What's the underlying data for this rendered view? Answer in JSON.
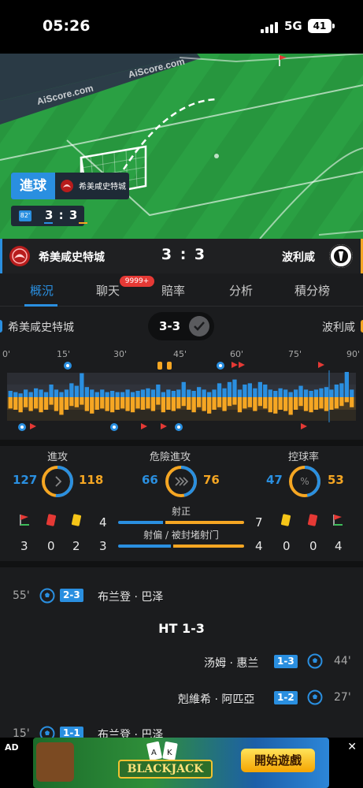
{
  "status_bar": {
    "time": "05:26",
    "network": "5G",
    "battery": "41"
  },
  "pitch": {
    "watermark_1": "AiScore.com",
    "watermark_2": "AiScore.com",
    "event_tag": "進球",
    "event_team": "希美咸史特城",
    "minute": "82'",
    "live_score": "3 : 3"
  },
  "scoreboard": {
    "home": "希美咸史特城",
    "away": "波利咸",
    "score": "3 : 3"
  },
  "tabs": [
    {
      "label": "概況",
      "active": true
    },
    {
      "label": "聊天",
      "badge": "9999+"
    },
    {
      "label": "賠率"
    },
    {
      "label": "分析"
    },
    {
      "label": "積分榜"
    }
  ],
  "match_info": {
    "home": "希美咸史特城",
    "away": "波利咸",
    "result": "3-3"
  },
  "momentum": {
    "ticks": [
      "0'",
      "15'",
      "30'",
      "45'",
      "60'",
      "75'",
      "90'"
    ],
    "home_values": [
      0.25,
      0.2,
      0.15,
      0.3,
      0.2,
      0.35,
      0.3,
      0.2,
      0.5,
      0.3,
      0.2,
      0.3,
      0.55,
      0.45,
      0.95,
      0.4,
      0.3,
      0.2,
      0.3,
      0.2,
      0.25,
      0.2,
      0.2,
      0.3,
      0.2,
      0.25,
      0.3,
      0.35,
      0.3,
      0.5,
      0.2,
      0.3,
      0.25,
      0.3,
      0.6,
      0.3,
      0.25,
      0.4,
      0.3,
      0.2,
      0.3,
      0.55,
      0.35,
      0.6,
      0.7,
      0.3,
      0.5,
      0.55,
      0.35,
      0.6,
      0.5,
      0.3,
      0.25,
      0.35,
      0.3,
      0.2,
      0.3,
      0.45,
      0.3,
      0.25,
      0.3,
      0.35,
      0.4,
      0.3,
      0.5,
      0.55,
      1.0,
      0.3
    ],
    "away_values": [
      0.45,
      0.5,
      0.6,
      0.4,
      0.55,
      0.45,
      0.6,
      0.5,
      0.3,
      0.55,
      0.7,
      0.5,
      0.35,
      0.4,
      0.3,
      0.55,
      0.65,
      0.5,
      0.45,
      0.55,
      0.6,
      0.5,
      0.45,
      0.55,
      0.6,
      0.45,
      0.5,
      0.45,
      0.55,
      0.3,
      0.6,
      0.5,
      0.55,
      0.45,
      0.35,
      0.5,
      0.6,
      0.4,
      0.55,
      0.65,
      0.5,
      0.4,
      0.55,
      0.35,
      0.3,
      0.6,
      0.45,
      0.4,
      0.55,
      0.35,
      0.45,
      0.6,
      0.65,
      0.5,
      0.55,
      0.7,
      0.5,
      0.35,
      0.55,
      0.6,
      0.5,
      0.45,
      0.55,
      0.5,
      0.45,
      0.35,
      0.2,
      0.4
    ]
  },
  "stats": {
    "attacks": {
      "label": "進攻",
      "home": "127",
      "away": "118",
      "home_frac": 0.518
    },
    "dangerous": {
      "label": "危險進攻",
      "home": "66",
      "away": "76",
      "home_frac": 0.465
    },
    "possession": {
      "label": "控球率",
      "home": "47",
      "away": "53",
      "home_frac": 0.47
    },
    "on_target": {
      "label": "射正",
      "home": "4",
      "away": "7",
      "home_frac": 0.364
    },
    "off_target": {
      "label": "射偏 / 被封堵射门",
      "home": "3",
      "away": "4",
      "home_frac": 0.43
    },
    "home_cards": {
      "corners": "3",
      "red": "0",
      "yellow": "2"
    },
    "away_cards": {
      "yellow": "0",
      "red": "0",
      "corners": "4"
    }
  },
  "events": {
    "e1": {
      "minute": "55'",
      "score": "2-3",
      "player": "布兰登 · 巴泽"
    },
    "ht": "HT 1-3",
    "e2": {
      "minute": "44'",
      "score": "1-3",
      "player": "汤姆 · 惠兰"
    },
    "e3": {
      "minute": "27'",
      "score": "1-2",
      "player": "剋維希 · 阿匹亞"
    },
    "e4": {
      "minute": "15'",
      "score": "1-1",
      "player": "布兰登 · 巴泽"
    }
  },
  "ad": {
    "tag": "AD",
    "close": "✕",
    "game": "BLACKJACK",
    "cta": "開始遊戲"
  },
  "colors": {
    "home": "#2a8fe0",
    "away": "#f5a623",
    "pitch": "#2aa043"
  }
}
